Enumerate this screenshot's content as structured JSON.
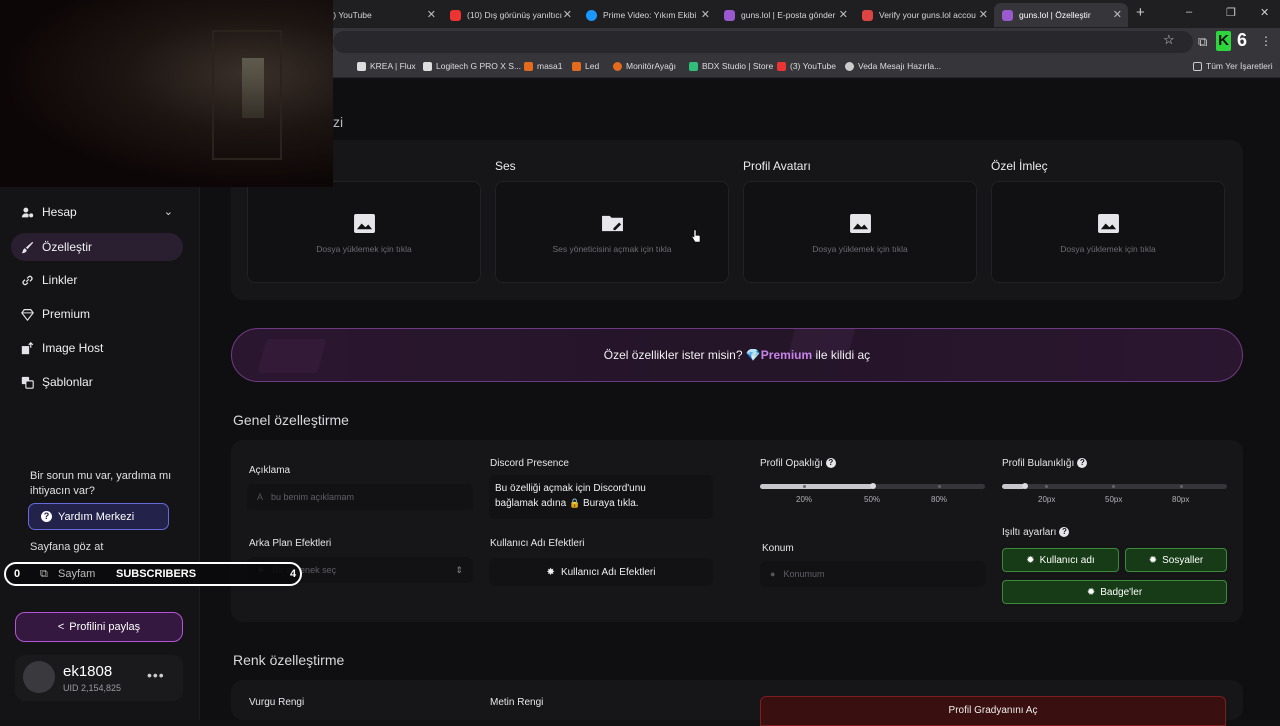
{
  "browser": {
    "tabs": [
      {
        "title": "(10) YouTube",
        "icon_color": "#e33"
      },
      {
        "title": "(10) Dış görünüş yanıltıcı",
        "icon_color": "#e33"
      },
      {
        "title": "Prime Video: Yıkım Ekibi",
        "icon_color": "#1a98ff"
      },
      {
        "title": "guns.lol | E-posta gönder",
        "icon_color": "#9b59d0"
      },
      {
        "title": "Verify your guns.lol accou",
        "icon_color": "#d44"
      },
      {
        "title": "guns.lol | Özelleştir",
        "icon_color": "#9b59d0"
      }
    ],
    "new_tab": "+",
    "win_controls": [
      "–",
      "❐",
      "✕"
    ],
    "ext_k": "K",
    "ext_count": "6",
    "bookmarks": [
      {
        "label": "KREA | Flux",
        "icon_color": "#ddd"
      },
      {
        "label": "Logitech G PRO X S...",
        "icon_color": "#ddd"
      },
      {
        "label": "masa1",
        "icon_color": "#e46a1e"
      },
      {
        "label": "Led",
        "icon_color": "#e46a1e"
      },
      {
        "label": "MonitörAyağı",
        "icon_color": "#e46a1e"
      },
      {
        "label": "BDX Studio | Store",
        "icon_color": "#2fbf7a"
      },
      {
        "label": "(3) YouTube",
        "icon_color": "#e33"
      },
      {
        "label": "Veda Mesajı Hazırla...",
        "icon_color": "#ccc"
      }
    ],
    "all_bookmarks": "Tüm Yer İşaretleri"
  },
  "sidebar": {
    "items": [
      {
        "label": "Hesap",
        "icon": "user-gear-icon"
      },
      {
        "label": "Özelleştir",
        "icon": "brush-icon"
      },
      {
        "label": "Linkler",
        "icon": "link-icon"
      },
      {
        "label": "Premium",
        "icon": "diamond-icon"
      },
      {
        "label": "Image Host",
        "icon": "image-upload-icon"
      },
      {
        "label": "Şablonlar",
        "icon": "templates-icon"
      }
    ],
    "help_text": "Bir sorun mu var, yardıma mı ihtiyacın var?",
    "help_button": "Yardım Merkezi",
    "page_text": "Sayfana göz at",
    "page_button": "Sayfam",
    "share_button": "Profilini paylaş",
    "user": {
      "name": "ek1808",
      "uid": "UID 2,154,825"
    }
  },
  "overlay": {
    "left_count": "0",
    "label": "SUBSCRIBERS",
    "right_count": "4"
  },
  "main": {
    "section_fragment": "zi",
    "assets": [
      {
        "title": "",
        "text": "Dosya yüklemek için tıkla"
      },
      {
        "title": "Ses",
        "text": "Ses yöneticisini açmak için tıkla"
      },
      {
        "title": "Profil Avatarı",
        "text": "Dosya yüklemek için tıkla"
      },
      {
        "title": "Özel İmleç",
        "text": "Dosya yüklemek için tıkla"
      }
    ],
    "premium_banner": {
      "before": "Özel özellikler ister misin?",
      "premium": "Premium",
      "after": "ile kilidi aç"
    },
    "general_title": "Genel özelleştirme",
    "description": {
      "label": "Açıklama",
      "placeholder": "bu benim açıklamam"
    },
    "discord": {
      "label": "Discord Presence",
      "line1": "Bu özelliği açmak için Discord'unu",
      "line2a": "bağlamak adına",
      "line2b": "Buraya tıkla."
    },
    "opacity": {
      "label": "Profil Opaklığı",
      "ticks": [
        "20%",
        "50%",
        "80%"
      ],
      "value": 50
    },
    "blur": {
      "label": "Profil Bulanıklığı",
      "ticks": [
        "20px",
        "50px",
        "80px"
      ],
      "value": 10
    },
    "bg_effects": {
      "label": "Arka Plan Efektleri",
      "placeholder": "Bir seçenek seç"
    },
    "username_effects": {
      "label": "Kullanıcı Adı Efektleri",
      "button": "Kullanıcı Adı Efektleri"
    },
    "location": {
      "label": "Konum",
      "placeholder": "Konumum"
    },
    "glow": {
      "label": "Işıltı ayarları",
      "buttons": [
        "Kullanıcı adı",
        "Sosyaller",
        "Badge'ler"
      ]
    },
    "color_title": "Renk özelleştirme",
    "accent_color": "Vurgu Rengi",
    "text_color": "Metin Rengi",
    "gradient_button": "Profil Gradyanını Aç"
  }
}
